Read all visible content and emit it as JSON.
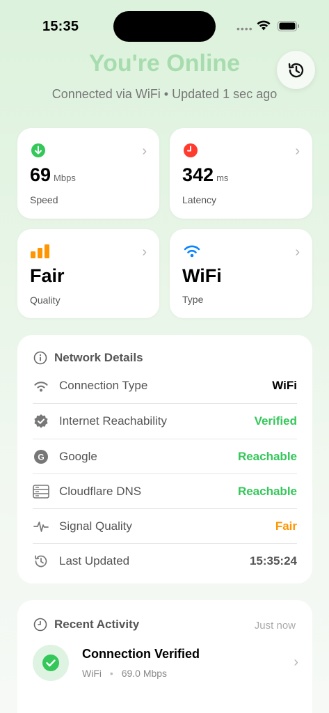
{
  "status_bar": {
    "time": "15:35"
  },
  "hero": {
    "title": "You're Online",
    "subtitle": "Connected via WiFi • Updated 1 sec ago"
  },
  "stats": [
    {
      "value": "69",
      "unit": "Mbps",
      "label": "Speed",
      "icon": "arrow-down-circle-icon",
      "color": "#34c759"
    },
    {
      "value": "342",
      "unit": "ms",
      "label": "Latency",
      "icon": "clock-icon",
      "color": "#ff3b30"
    },
    {
      "value": "Fair",
      "unit": "",
      "label": "Quality",
      "icon": "signal-bars-icon",
      "color": "#ff9500"
    },
    {
      "value": "WiFi",
      "unit": "",
      "label": "Type",
      "icon": "wifi-icon",
      "color": "#0a84ff"
    }
  ],
  "details": {
    "title": "Network Details",
    "rows": [
      {
        "label": "Connection Type",
        "value": "WiFi",
        "value_color": "#000000",
        "icon": "wifi-icon"
      },
      {
        "label": "Internet Reachability",
        "value": "Verified",
        "value_color": "#34c759",
        "icon": "verified-badge-icon"
      },
      {
        "label": "Google",
        "value": "Reachable",
        "value_color": "#34c759",
        "icon": "google-icon"
      },
      {
        "label": "Cloudflare DNS",
        "value": "Reachable",
        "value_color": "#34c759",
        "icon": "server-icon"
      },
      {
        "label": "Signal Quality",
        "value": "Fair",
        "value_color": "#ff9500",
        "icon": "waveform-icon"
      },
      {
        "label": "Last Updated",
        "value": "15:35:24",
        "value_color": "#555555",
        "icon": "history-icon"
      }
    ]
  },
  "activity": {
    "title": "Recent Activity",
    "time": "Just now",
    "item": {
      "title": "Connection Verified",
      "type": "WiFi",
      "separator": "•",
      "speed": "69.0 Mbps"
    }
  },
  "colors": {
    "accent_green": "#34c759",
    "hero_title": "#a7dcae"
  }
}
